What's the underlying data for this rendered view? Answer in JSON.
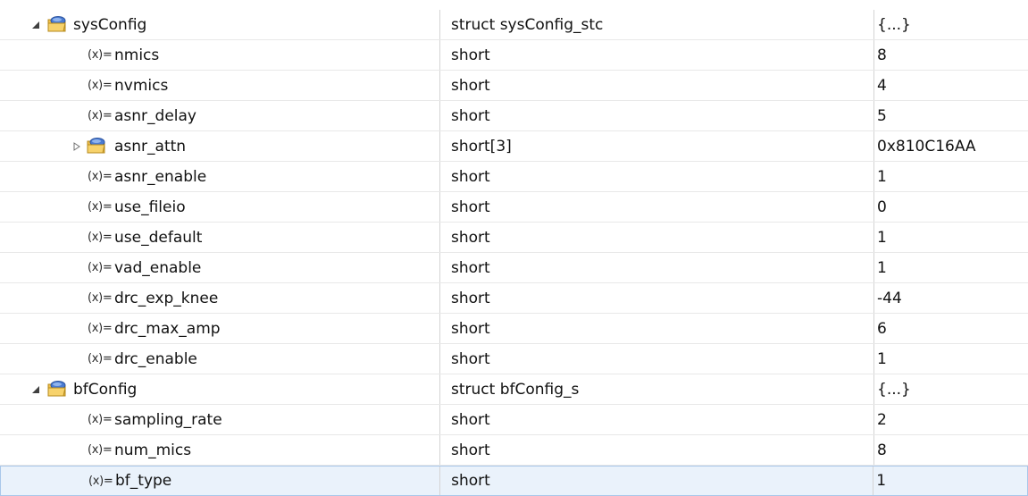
{
  "icons": {
    "variable": "(x)=",
    "struct": "struct-folder-icon",
    "expanded": "triangle-expanded-icon",
    "collapsed": "triangle-collapsed-icon"
  },
  "rows": [
    {
      "name": "sysConfig",
      "type": "struct sysConfig_stc",
      "value": "{...}",
      "kind": "struct",
      "expander": "expanded"
    },
    {
      "name": "nmics",
      "type": "short",
      "value": "8",
      "kind": "var"
    },
    {
      "name": "nvmics",
      "type": "short",
      "value": "4",
      "kind": "var"
    },
    {
      "name": "asnr_delay",
      "type": "short",
      "value": "5",
      "kind": "var"
    },
    {
      "name": "asnr_attn",
      "type": "short[3]",
      "value": "0x810C16AA",
      "kind": "struct-child",
      "expander": "collapsed"
    },
    {
      "name": "asnr_enable",
      "type": "short",
      "value": "1",
      "kind": "var"
    },
    {
      "name": "use_fileio",
      "type": "short",
      "value": "0",
      "kind": "var"
    },
    {
      "name": "use_default",
      "type": "short",
      "value": "1",
      "kind": "var"
    },
    {
      "name": "vad_enable",
      "type": "short",
      "value": "1",
      "kind": "var"
    },
    {
      "name": "drc_exp_knee",
      "type": "short",
      "value": "-44",
      "kind": "var"
    },
    {
      "name": "drc_max_amp",
      "type": "short",
      "value": "6",
      "kind": "var"
    },
    {
      "name": "drc_enable",
      "type": "short",
      "value": "1",
      "kind": "var"
    },
    {
      "name": "bfConfig",
      "type": "struct bfConfig_s",
      "value": "{...}",
      "kind": "struct",
      "expander": "expanded"
    },
    {
      "name": "sampling_rate",
      "type": "short",
      "value": "2",
      "kind": "var"
    },
    {
      "name": "num_mics",
      "type": "short",
      "value": "8",
      "kind": "var"
    },
    {
      "name": "bf_type",
      "type": "short",
      "value": "1",
      "kind": "var",
      "selected": true
    }
  ]
}
